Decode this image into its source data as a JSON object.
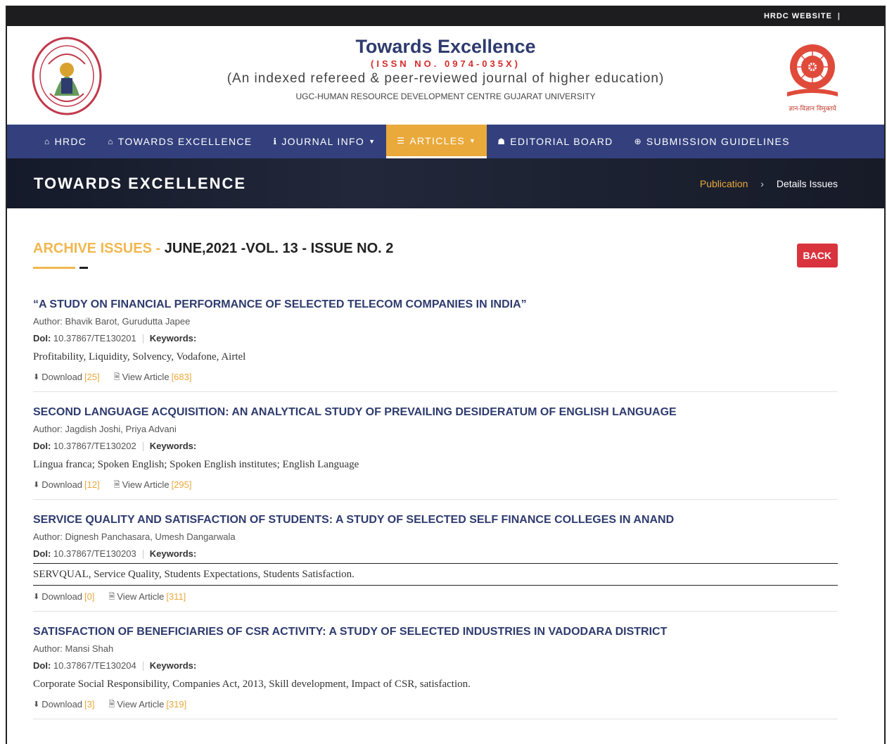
{
  "topbar": {
    "link": "HRDC WEBSITE",
    "separator": "|"
  },
  "header": {
    "title": "Towards Excellence",
    "issn": "(ISSN NO. 0974-035X)",
    "tagline": "(An indexed refereed & peer-reviewed journal of higher education)",
    "department": "UGC-HUMAN RESOURCE DEVELOPMENT CENTRE GUJARAT UNIVERSITY",
    "right_logo_caption": "ज्ञान-विज्ञान विमुक्तये"
  },
  "nav": [
    {
      "label": "HRDC",
      "icon": "home-icon",
      "glyph": "⌂"
    },
    {
      "label": "TOWARDS EXCELLENCE",
      "icon": "home-icon",
      "glyph": "⌂"
    },
    {
      "label": "JOURNAL INFO",
      "icon": "info-icon",
      "glyph": "ℹ",
      "caret": "▼"
    },
    {
      "label": "ARTICLES",
      "icon": "list-icon",
      "glyph": "☰",
      "caret": "▼"
    },
    {
      "label": "EDITORIAL BOARD",
      "icon": "users-icon",
      "glyph": "☗"
    },
    {
      "label": "SUBMISSION GUIDELINES",
      "icon": "lifebuoy-icon",
      "glyph": "⊕"
    }
  ],
  "banner": {
    "title": "TOWARDS EXCELLENCE",
    "crumb_link": "Publication",
    "crumb_sep": "›",
    "crumb_current": "Details Issues"
  },
  "archive": {
    "label": "ARCHIVE ISSUES - ",
    "issue": "JUNE,2021 -VOL. 13 - ISSUE NO. 2",
    "back_label": "BACK"
  },
  "labels": {
    "doi": "DoI:",
    "keywords": "Keywords:",
    "download": "Download",
    "view_article": "View Article"
  },
  "articles": [
    {
      "title": "“A STUDY ON FINANCIAL PERFORMANCE OF SELECTED TELECOM COMPANIES IN INDIA”",
      "author": "Author: Bhavik Barot, Gurudutta Japee",
      "doi": "10.37867/TE130201",
      "keywords": "Profitability, Liquidity, Solvency, Vodafone, Airtel",
      "downloads": "[25]",
      "views": "[683]"
    },
    {
      "title": "SECOND LANGUAGE ACQUISITION: AN ANALYTICAL STUDY OF PREVAILING DESIDERATUM OF ENGLISH LANGUAGE",
      "author": "Author: Jagdish Joshi, Priya Advani",
      "doi": "10.37867/TE130202",
      "keywords": "Lingua franca; Spoken English; Spoken English institutes; English Language",
      "downloads": "[12]",
      "views": "[295]"
    },
    {
      "title": "SERVICE QUALITY AND SATISFACTION OF STUDENTS: A STUDY OF SELECTED SELF FINANCE COLLEGES IN ANAND",
      "author": "Author: Dignesh Panchasara, Umesh Dangarwala",
      "doi": "10.37867/TE130203",
      "keywords": "SERVQUAL, Service Quality, Students Expectations, Students Satisfaction.",
      "downloads": "[0]",
      "views": "[311]"
    },
    {
      "title": "SATISFACTION OF BENEFICIARIES OF CSR ACTIVITY: A STUDY OF SELECTED INDUSTRIES IN VADODARA DISTRICT",
      "author": "Author: Mansi Shah",
      "doi": "10.37867/TE130204",
      "keywords": "Corporate Social Responsibility, Companies Act, 2013, Skill development, Impact of CSR, satisfaction.",
      "downloads": "[3]",
      "views": "[319]"
    }
  ]
}
